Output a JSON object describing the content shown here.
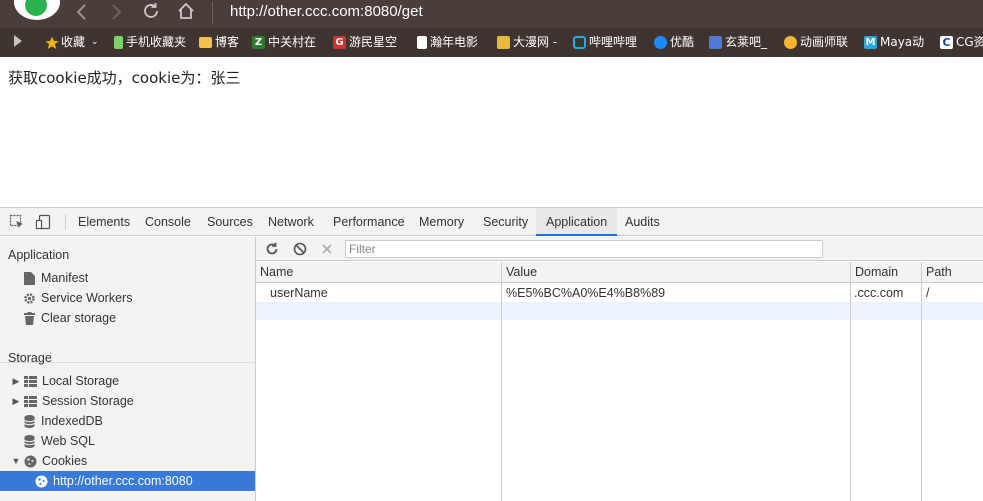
{
  "browser": {
    "address": "http://other.ccc.com:8080/get",
    "bookmarks": [
      {
        "label": "收藏",
        "icon": "star-icon",
        "color": "#f5b800"
      },
      {
        "label": "手机收藏夹",
        "icon": "phone-icon",
        "color": "#7bd36a"
      },
      {
        "label": "博客",
        "icon": "folder-icon",
        "color": "#f1c24a"
      },
      {
        "label": "中关村在",
        "icon": "z-icon",
        "color": "#2a7d2e"
      },
      {
        "label": "游民星空",
        "icon": "g-icon",
        "color": "#d32f2f"
      },
      {
        "label": "瀚年电影",
        "icon": "page-icon",
        "color": "#ffffff"
      },
      {
        "label": "大漫网 -",
        "icon": "manga-icon",
        "color": "#e6b83c"
      },
      {
        "label": "哔哩哔哩",
        "icon": "tv-icon",
        "color": "#23ade5"
      },
      {
        "label": "优酷",
        "icon": "youku-icon",
        "color": "#1a8cff"
      },
      {
        "label": "玄莱吧_",
        "icon": "paw-icon",
        "color": "#4a7bd6"
      },
      {
        "label": "动画师联",
        "icon": "duck-icon",
        "color": "#f7b731"
      },
      {
        "label": "Maya动",
        "icon": "m-icon",
        "color": "#2aa7df"
      },
      {
        "label": "CG资",
        "icon": "c-icon",
        "color": "#1e40af"
      }
    ]
  },
  "page": {
    "message": "获取cookie成功，cookie为：张三"
  },
  "devtools": {
    "tabs": [
      "Elements",
      "Console",
      "Sources",
      "Network",
      "Performance",
      "Memory",
      "Security",
      "Application",
      "Audits"
    ],
    "active_tab": "Application",
    "sidebar": {
      "application_title": "Application",
      "application_items": [
        "Manifest",
        "Service Workers",
        "Clear storage"
      ],
      "storage_title": "Storage",
      "storage_items": [
        "Local Storage",
        "Session Storage",
        "IndexedDB",
        "Web SQL",
        "Cookies"
      ],
      "cookie_origin": "http://other.ccc.com:8080"
    },
    "filter_placeholder": "Filter",
    "columns": [
      "Name",
      "Value",
      "Domain",
      "Path"
    ],
    "rows": [
      {
        "name": "userName",
        "value": "%E5%BC%A0%E4%B8%89",
        "domain": ".ccc.com",
        "path": "/"
      }
    ]
  }
}
